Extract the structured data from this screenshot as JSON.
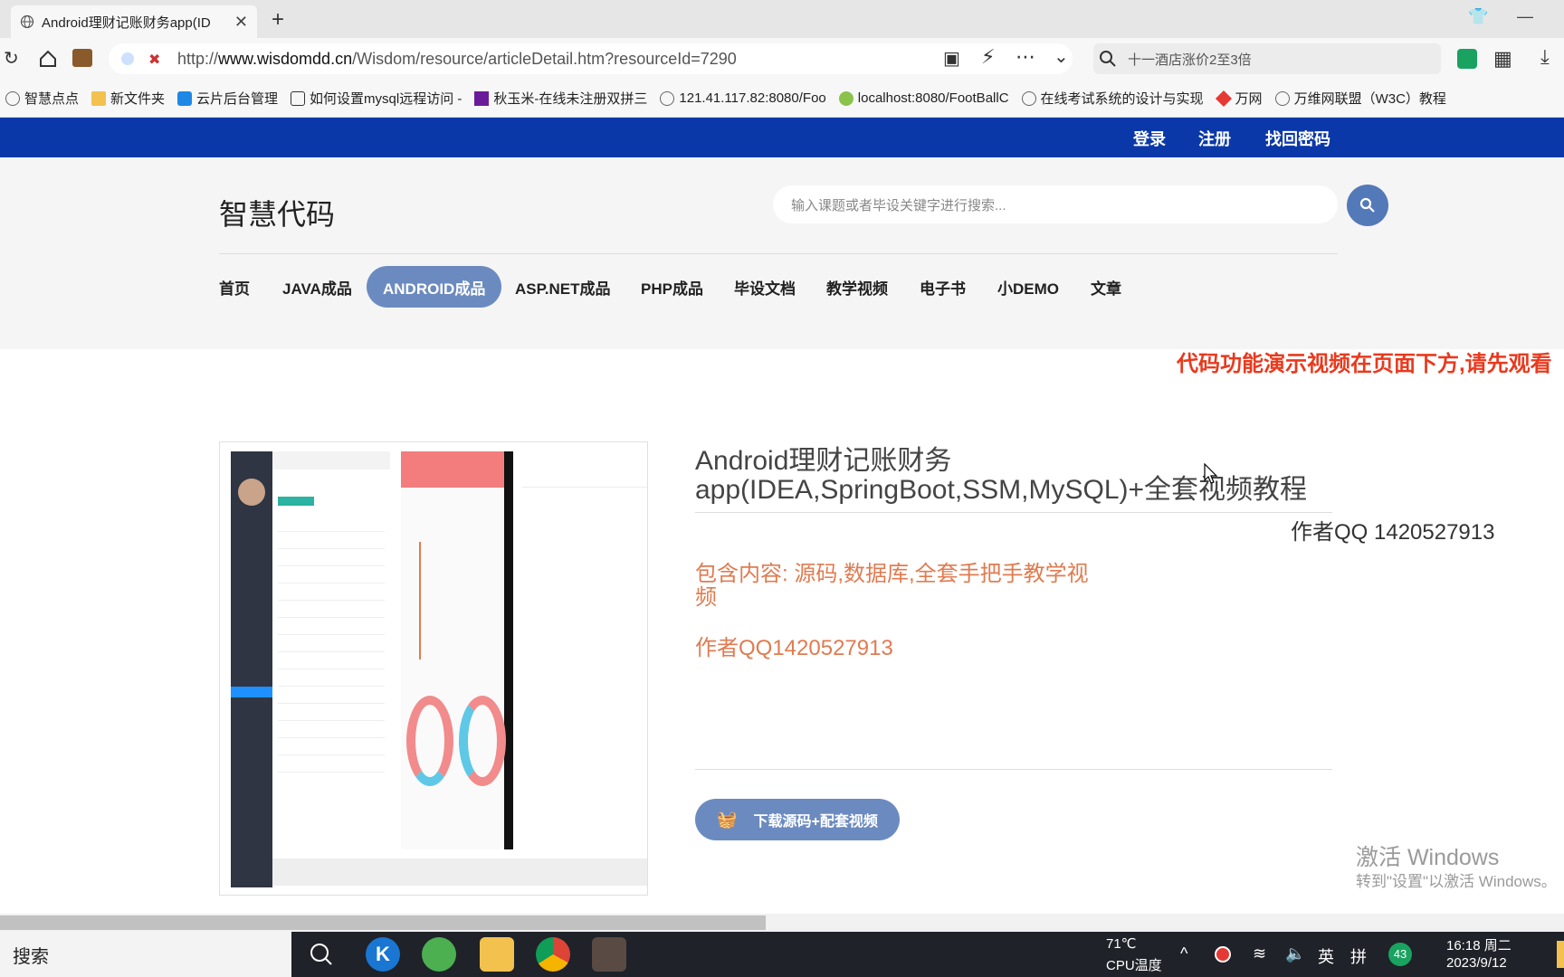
{
  "browser": {
    "tab_title": "Android理财记账财务app(ID",
    "url_prefix": "http://",
    "url_host": "www.wisdomdd.cn",
    "url_path": "/Wisdom/resource/articleDetail.htm?resourceId=7290",
    "search_text": "十一酒店涨价2至3倍",
    "bookmarks": [
      "智慧点点",
      "新文件夹",
      "云片后台管理",
      "如何设置mysql远程访问 -",
      "秋玉米-在线未注册双拼三",
      "121.41.117.82:8080/Foo",
      "localhost:8080/FootBallC",
      "在线考试系统的设计与实现",
      "万网",
      "万维网联盟（W3C）教程"
    ]
  },
  "site": {
    "top_links": [
      "登录",
      "注册",
      "找回密码"
    ],
    "logo": "智慧代码",
    "search_placeholder": "输入课题或者毕设关键字进行搜索...",
    "nav": [
      "首页",
      "JAVA成品",
      "ANDROID成品",
      "ASP.NET成品",
      "PHP成品",
      "毕设文档",
      "教学视频",
      "电子书",
      "小DEMO",
      "文章"
    ],
    "nav_active_index": 2,
    "marquee": "代码功能演示视频在页面下方,请先观看",
    "article": {
      "title": "Android理财记账财务app(IDEA,SpringBoot,SSM,MySQL)+全套视频教程",
      "author_qq": "作者QQ 1420527913",
      "contains": "包含内容: 源码,数据库,全套手把手教学视频",
      "author_qq2": "作者QQ1420527913",
      "download_button": "下载源码+配套视频"
    }
  },
  "windows": {
    "activate_title": "激活 Windows",
    "activate_sub": "转到\"设置\"以激活 Windows。"
  },
  "taskbar": {
    "search": "搜索",
    "temp": "71℃",
    "temp_label": "CPU温度",
    "ime_lang": "英",
    "ime_mode": "拼",
    "badge": "43",
    "time": "16:18 周二",
    "date": "2023/9/12"
  },
  "colors": {
    "topbar": "#0b38a8",
    "accent": "#6b8bc0",
    "marquee": "#e83a1e",
    "orange_text": "#e07b50"
  }
}
